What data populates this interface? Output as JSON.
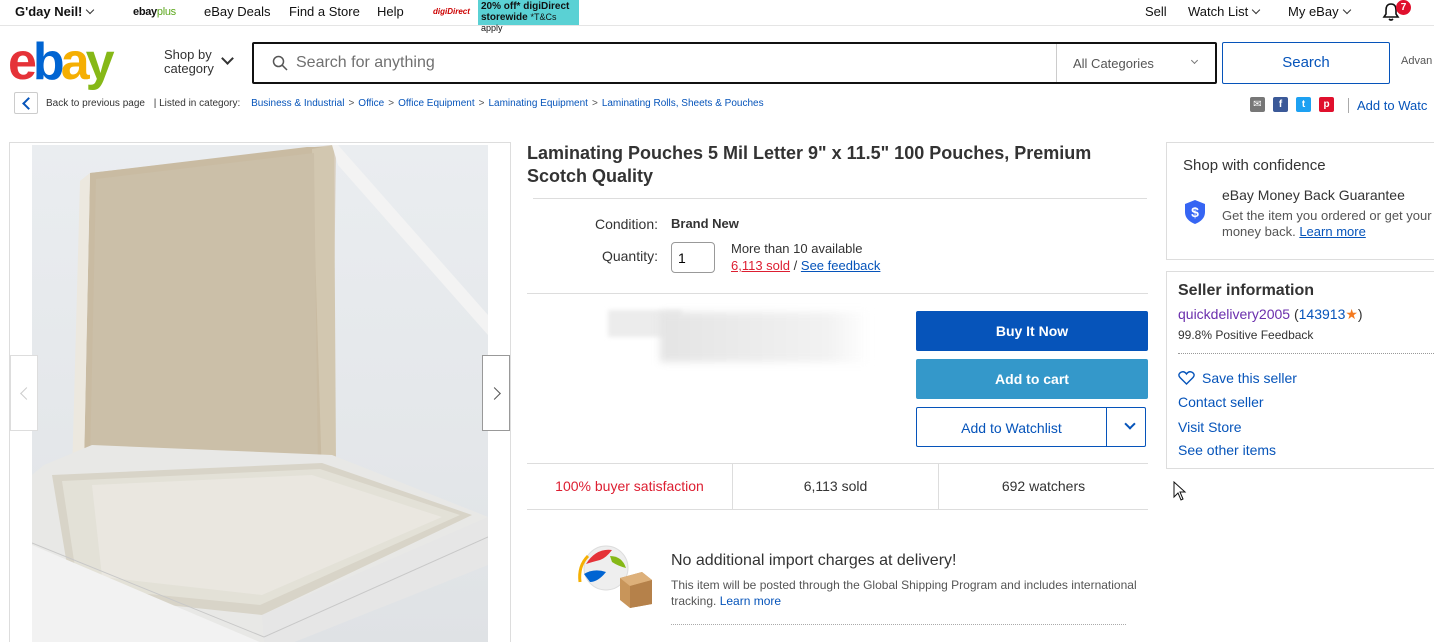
{
  "topbar": {
    "greeting": "G'day Neil!",
    "ebayplus_a": "ebay",
    "ebayplus_b": "plus",
    "deals": "eBay Deals",
    "find_store": "Find a Store",
    "help": "Help",
    "promo_logo": "digiDirect",
    "promo_line1": "20% off* digiDirect",
    "promo_line2": "storewide",
    "promo_tc": "*T&Cs apply",
    "sell": "Sell",
    "watch_list": "Watch List",
    "my_ebay": "My eBay",
    "notifications_count": "7"
  },
  "header": {
    "logo": [
      "e",
      "b",
      "a",
      "y"
    ],
    "shop_by_1": "Shop by",
    "shop_by_2": "category",
    "search_placeholder": "Search for anything",
    "category": "All Categories",
    "search_button": "Search",
    "advanced": "Advan"
  },
  "breadcrumb": {
    "back": "Back to previous page",
    "listed": "| Listed in category:",
    "items": [
      "Business & Industrial",
      "Office",
      "Office Equipment",
      "Laminating Equipment",
      "Laminating Rolls, Sheets & Pouches"
    ],
    "add_to_watchlist": "Add to Watc"
  },
  "listing": {
    "title": "Laminating Pouches 5 Mil Letter 9\" x 11.5\" 100 Pouches, Premium Scotch Quality",
    "condition_label": "Condition:",
    "condition": "Brand New",
    "quantity_label": "Quantity:",
    "quantity_value": "1",
    "available": "More than 10 available",
    "sold_link": "6,113 sold",
    "slash": "/",
    "feedback_link": "See feedback",
    "buy_now": "Buy It Now",
    "add_to_cart": "Add to cart",
    "add_to_watchlist": "Add to Watchlist",
    "stat_satisfaction": "100% buyer satisfaction",
    "stat_sold": "6,113 sold",
    "stat_watchers": "692 watchers",
    "import_title": "No additional import charges at delivery!",
    "import_text": "This item will be posted through the Global Shipping Program and includes international tracking.",
    "learn_more": "Learn more"
  },
  "confidence": {
    "title": "Shop with confidence",
    "guarantee": "eBay Money Back Guarantee",
    "desc": "Get the item you ordered or get your money back.",
    "learn_more": "Learn more"
  },
  "seller": {
    "title": "Seller information",
    "name": "quickdelivery2005",
    "score": "143913",
    "positive": "99.8% Positive Feedback",
    "save": "Save this seller",
    "contact": "Contact seller",
    "visit": "Visit Store",
    "other": "See other items"
  },
  "colors": {
    "ebay_blue": "#0654ba",
    "cart_blue": "#3498ca",
    "red": "#dd1e31",
    "seller_purple": "#6b2fad"
  }
}
